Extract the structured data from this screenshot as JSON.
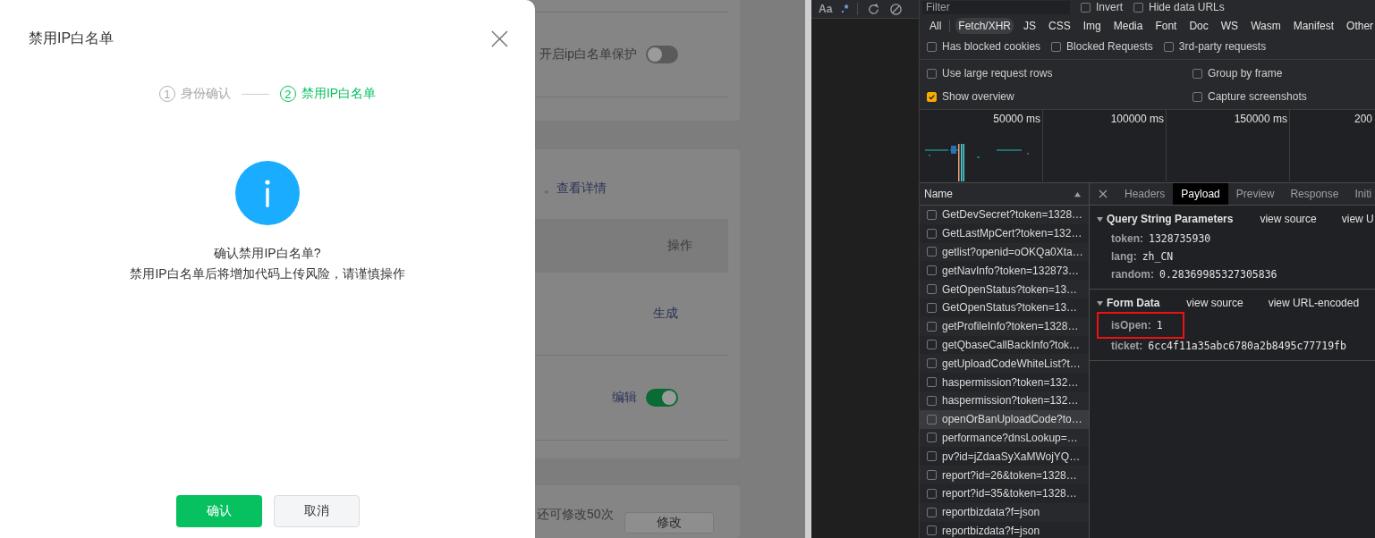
{
  "background_page": {
    "whitelist_toggle": {
      "label": "开启ip白名单保护",
      "on": false
    },
    "notice": {
      "text": "。",
      "link": "查看详情"
    },
    "table_header": "操作",
    "generate_link": "生成",
    "edit_row": {
      "label": "编辑",
      "on": true
    },
    "quota_text": "还可修改50次",
    "modify_button": "修改"
  },
  "dialog": {
    "title": "禁用IP白名单",
    "steps": [
      {
        "number": "1",
        "label": "身份确认",
        "selected": false
      },
      {
        "number": "2",
        "label": "禁用IP白名单",
        "selected": true
      }
    ],
    "message": "确认禁用IP白名单?",
    "warning": "禁用IP白名单后将增加代码上传风险，请谨慎操作",
    "buttons": [
      {
        "label": "确认",
        "kind": "primary"
      },
      {
        "label": "取消",
        "kind": "default"
      }
    ]
  },
  "devtools": {
    "search_toolbar": {
      "case_toggle": "Aa",
      "regex_toggle": ".*"
    },
    "filter": {
      "placeholder": "Filter"
    },
    "filter_options": [
      {
        "label": "Invert",
        "checked": false
      },
      {
        "label": "Hide data URLs",
        "checked": false
      }
    ],
    "type_filters": [
      {
        "label": "All",
        "selected": false
      },
      {
        "label": "Fetch/XHR",
        "selected": true
      },
      {
        "label": "JS",
        "selected": false
      },
      {
        "label": "CSS",
        "selected": false
      },
      {
        "label": "Img",
        "selected": false
      },
      {
        "label": "Media",
        "selected": false
      },
      {
        "label": "Font",
        "selected": false
      },
      {
        "label": "Doc",
        "selected": false
      },
      {
        "label": "WS",
        "selected": false
      },
      {
        "label": "Wasm",
        "selected": false
      },
      {
        "label": "Manifest",
        "selected": false
      },
      {
        "label": "Other",
        "selected": false
      }
    ],
    "request_filters": [
      {
        "label": "Has blocked cookies",
        "checked": false
      },
      {
        "label": "Blocked Requests",
        "checked": false
      },
      {
        "label": "3rd-party requests",
        "checked": false
      }
    ],
    "settings": [
      {
        "label": "Use large request rows",
        "checked": false
      },
      {
        "label": "Group by frame",
        "checked": false
      },
      {
        "label": "Show overview",
        "checked": true
      },
      {
        "label": "Capture screenshots",
        "checked": false
      }
    ],
    "overview_ticks": [
      "50000 ms",
      "100000 ms",
      "150000 ms",
      "200"
    ],
    "requests": {
      "column": "Name",
      "rows": [
        {
          "name": "GetDevSecret?token=1328…",
          "selected": false
        },
        {
          "name": "GetLastMpCert?token=132…",
          "selected": false
        },
        {
          "name": "getlist?openid=oOKQa0Xta…",
          "selected": false
        },
        {
          "name": "getNavInfo?token=132873…",
          "selected": false
        },
        {
          "name": "GetOpenStatus?token=13…",
          "selected": false
        },
        {
          "name": "GetOpenStatus?token=13…",
          "selected": false
        },
        {
          "name": "getProfileInfo?token=1328…",
          "selected": false
        },
        {
          "name": "getQbaseCallBackInfo?tok…",
          "selected": false
        },
        {
          "name": "getUploadCodeWhiteList?t…",
          "selected": false
        },
        {
          "name": "haspermission?token=132…",
          "selected": false
        },
        {
          "name": "haspermission?token=132…",
          "selected": false
        },
        {
          "name": "openOrBanUploadCode?to…",
          "selected": true
        },
        {
          "name": "performance?dnsLookup=…",
          "selected": false
        },
        {
          "name": "pv?id=jZdaaSyXaMWojYQ…",
          "selected": false
        },
        {
          "name": "report?id=26&token=1328…",
          "selected": false
        },
        {
          "name": "report?id=35&token=1328…",
          "selected": false
        },
        {
          "name": "reportbizdata?f=json",
          "selected": false
        },
        {
          "name": "reportbizdata?f=json",
          "selected": false
        }
      ]
    },
    "detail_tabs": [
      {
        "label": "Headers",
        "selected": false
      },
      {
        "label": "Payload",
        "selected": true
      },
      {
        "label": "Preview",
        "selected": false
      },
      {
        "label": "Response",
        "selected": false
      },
      {
        "label": "Initi",
        "selected": false
      }
    ],
    "query_string": {
      "title": "Query String Parameters",
      "actions": [
        "view source",
        "view U"
      ],
      "params": [
        {
          "key": "token:",
          "value": "1328735930",
          "highlighted": false
        },
        {
          "key": "lang:",
          "value": "zh_CN",
          "highlighted": false
        },
        {
          "key": "random:",
          "value": "0.28369985327305836",
          "highlighted": false
        }
      ]
    },
    "form_data": {
      "title": "Form Data",
      "actions": [
        "view source",
        "view URL-encoded"
      ],
      "params": [
        {
          "key": "isOpen:",
          "value": "1",
          "highlighted": true
        },
        {
          "key": "ticket:",
          "value": "6cc4f11a35abc6780a2b8495c77719fb",
          "highlighted": false
        }
      ]
    }
  }
}
